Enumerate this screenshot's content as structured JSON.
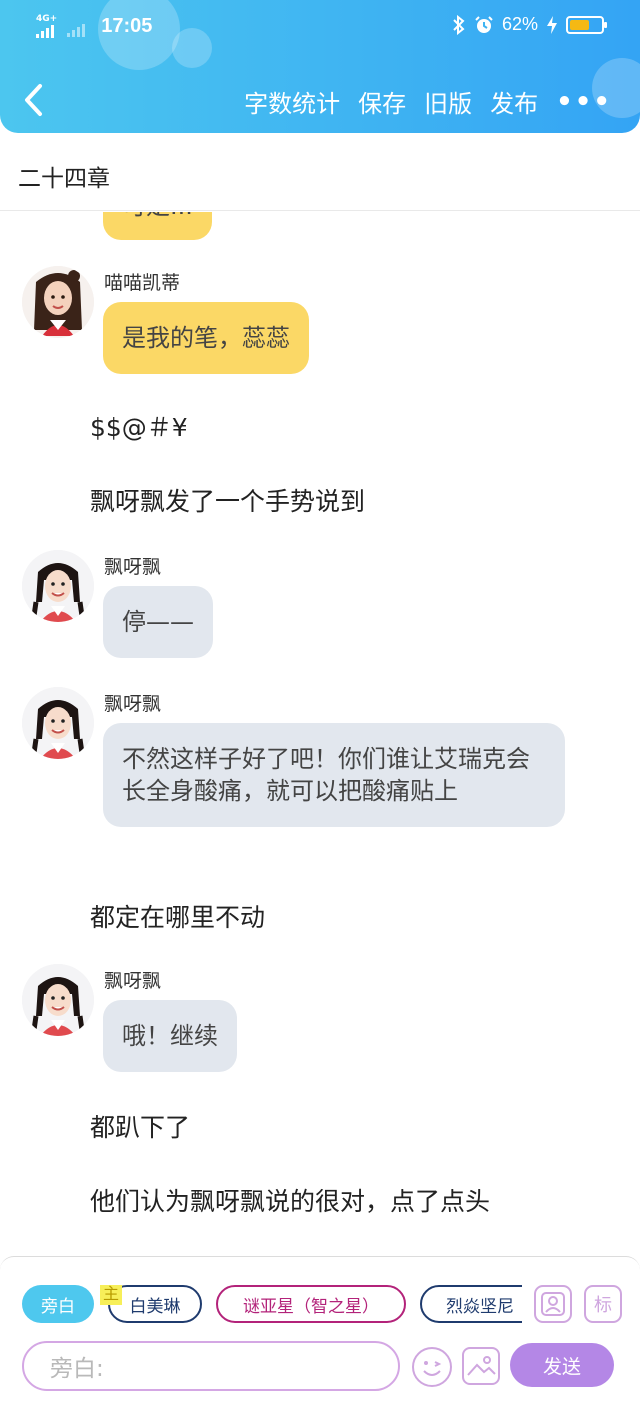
{
  "status_bar": {
    "network": "4G+",
    "time": "17:05",
    "battery": "62%",
    "battery_level": 0.62
  },
  "toolbar": {
    "back_icon": "chevron-left-icon",
    "word_count": "字数统计",
    "save": "保存",
    "old_version": "旧版",
    "publish": "发布",
    "more": "•••"
  },
  "chapter": {
    "title": "二十四章"
  },
  "messages": [
    {
      "partial_text": "可是..."
    },
    {
      "speaker": "喵喵凯蒂",
      "text": "是我的笔，蕊蕊"
    },
    {
      "narration": "$$@＃¥"
    },
    {
      "narration": "飘呀飘发了一个手势说到"
    },
    {
      "speaker": "飘呀飘",
      "text": "停——"
    },
    {
      "speaker": "飘呀飘",
      "text": "不然这样子好了吧！你们谁让艾瑞克会长全身酸痛，就可以把酸痛贴上"
    },
    {
      "narration": "都定在哪里不动"
    },
    {
      "speaker": "飘呀飘",
      "text": "哦！继续"
    },
    {
      "narration": "都趴下了"
    },
    {
      "narration": "他们认为飘呀飘说的很对，点了点头"
    }
  ],
  "composer": {
    "characters": [
      "旁白",
      "白美琳",
      "谜亚星（智之星）",
      "烈焱坚尼"
    ],
    "main_badge": "主",
    "tag_button": "标",
    "placeholder": "旁白:",
    "send": "发送"
  }
}
